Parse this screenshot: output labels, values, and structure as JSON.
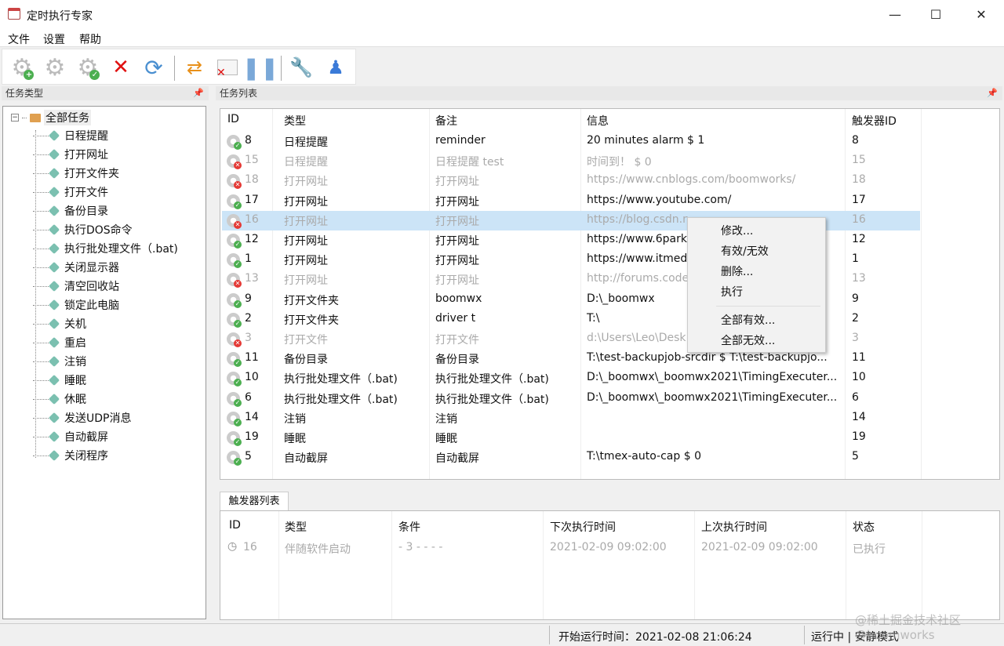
{
  "window": {
    "title": "定时执行专家",
    "minimize": "—",
    "maximize": "☐",
    "close": "✕"
  },
  "menubar": [
    "文件",
    "设置",
    "帮助"
  ],
  "toolbar": {
    "icons": [
      "add-task-icon",
      "task-settings-icon",
      "enable-task-icon",
      "delete-icon",
      "refresh-icon",
      "switch-icon",
      "close-window-icon",
      "pause-icon",
      "tools-icon",
      "user-icon"
    ]
  },
  "left_panel": {
    "title": "任务类型",
    "root": "全部任务",
    "items": [
      "日程提醒",
      "打开网址",
      "打开文件夹",
      "打开文件",
      "备份目录",
      "执行DOS命令",
      "执行批处理文件（.bat)",
      "关闭显示器",
      "清空回收站",
      "锁定此电脑",
      "关机",
      "重启",
      "注销",
      "睡眠",
      "休眠",
      "发送UDP消息",
      "自动截屏",
      "关闭程序"
    ]
  },
  "task_panel": {
    "title": "任务列表",
    "columns": [
      "ID",
      "类型",
      "备注",
      "信息",
      "触发器ID"
    ],
    "rows": [
      {
        "id": "8",
        "type": "日程提醒",
        "note": "reminder",
        "info": "20 minutes alarm $ 1",
        "trigger": "8",
        "enabled": true
      },
      {
        "id": "15",
        "type": "日程提醒",
        "note": "日程提醒 test",
        "info": "时间到！ $ 0",
        "trigger": "15",
        "enabled": false
      },
      {
        "id": "18",
        "type": "打开网址",
        "note": "打开网址",
        "info": "https://www.cnblogs.com/boomworks/",
        "trigger": "18",
        "enabled": false
      },
      {
        "id": "17",
        "type": "打开网址",
        "note": "打开网址",
        "info": "https://www.youtube.com/",
        "trigger": "17",
        "enabled": true
      },
      {
        "id": "16",
        "type": "打开网址",
        "note": "打开网址",
        "info": "https://blog.csdn.n",
        "trigger": "16",
        "enabled": false,
        "selected": true
      },
      {
        "id": "12",
        "type": "打开网址",
        "note": "打开网址",
        "info": "https://www.6park",
        "trigger": "12",
        "enabled": true
      },
      {
        "id": "1",
        "type": "打开网址",
        "note": "打开网址",
        "info": "https://www.itmed",
        "trigger": "1",
        "enabled": true
      },
      {
        "id": "13",
        "type": "打开网址",
        "note": "打开网址",
        "info": "http://forums.code",
        "trigger": "13",
        "enabled": false
      },
      {
        "id": "9",
        "type": "打开文件夹",
        "note": "boomwx",
        "info": "D:\\_boomwx",
        "trigger": "9",
        "enabled": true
      },
      {
        "id": "2",
        "type": "打开文件夹",
        "note": "driver t",
        "info": "T:\\",
        "trigger": "2",
        "enabled": true
      },
      {
        "id": "3",
        "type": "打开文件",
        "note": "打开文件",
        "info": "d:\\Users\\Leo\\Desk",
        "trigger": "3",
        "enabled": false
      },
      {
        "id": "11",
        "type": "备份目录",
        "note": "备份目录",
        "info": "T:\\test-backupjob-srcdir $ T:\\test-backupjo...",
        "trigger": "11",
        "enabled": true
      },
      {
        "id": "10",
        "type": "执行批处理文件（.bat)",
        "note": "执行批处理文件（.bat)",
        "info": "D:\\_boomwx\\_boomwx2021\\TimingExecuter...",
        "trigger": "10",
        "enabled": true
      },
      {
        "id": "6",
        "type": "执行批处理文件（.bat)",
        "note": "执行批处理文件（.bat)",
        "info": "D:\\_boomwx\\_boomwx2021\\TimingExecuter...",
        "trigger": "6",
        "enabled": true
      },
      {
        "id": "14",
        "type": "注销",
        "note": "注销",
        "info": "",
        "trigger": "14",
        "enabled": true
      },
      {
        "id": "19",
        "type": "睡眠",
        "note": "睡眠",
        "info": "",
        "trigger": "19",
        "enabled": true
      },
      {
        "id": "5",
        "type": "自动截屏",
        "note": "自动截屏",
        "info": "T:\\tmex-auto-cap $ 0",
        "trigger": "5",
        "enabled": true
      }
    ]
  },
  "context_menu": [
    "修改...",
    "有效/无效",
    "删除...",
    "执行",
    "全部有效...",
    "全部无效..."
  ],
  "trigger_panel": {
    "tab": "触发器列表",
    "columns": [
      "ID",
      "类型",
      "条件",
      "下次执行时间",
      "上次执行时间",
      "状态"
    ],
    "rows": [
      {
        "id": "16",
        "type": "伴随软件启动",
        "condition": "- 3 - - - -",
        "next": "2021-02-09 09:02:00",
        "last": "2021-02-09 09:02:00",
        "status": "已执行"
      }
    ]
  },
  "statusbar": {
    "start_time": "开始运行时间：2021-02-08 21:06:24",
    "state": "运行中 | 安静模式"
  },
  "watermark": "@稀土掘金技术社区 @boomworks",
  "colors": {
    "enabled": "#4caf50",
    "disabled": "#e53935",
    "selection": "#cce4f7"
  }
}
